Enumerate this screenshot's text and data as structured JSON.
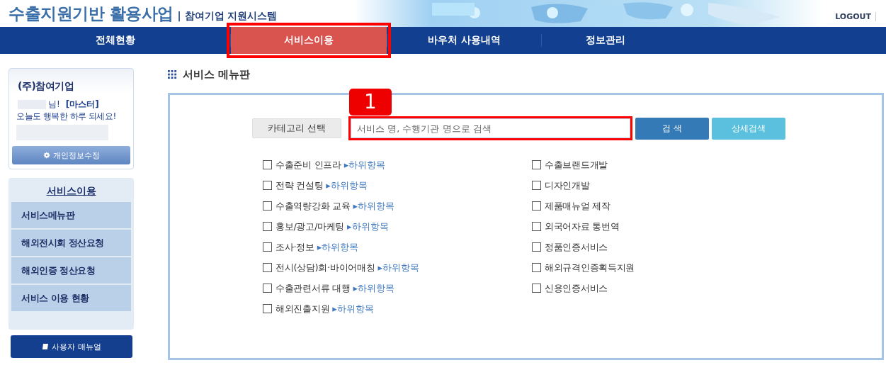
{
  "header": {
    "title": "수출지원기반 활용사업",
    "subtitle": "| 참여기업 지원시스템",
    "logout": "LOGOUT"
  },
  "nav": [
    {
      "label": "전체현황",
      "selected": false,
      "highlighted": false
    },
    {
      "label": "서비스이용",
      "selected": true,
      "highlighted": true
    },
    {
      "label": "바우처 사용내역",
      "selected": false,
      "highlighted": false
    },
    {
      "label": "정보관리",
      "selected": false,
      "highlighted": false
    }
  ],
  "profile": {
    "company": "(주)참여기업",
    "greeting": "님!",
    "role": "[마스터]",
    "message": "오늘도 행복한 하루 되세요!",
    "edit_button": "개인정보수정"
  },
  "side_menu": {
    "title": "서비스이용",
    "items": [
      {
        "label": "서비스메뉴판",
        "selected": false
      },
      {
        "label": "해외전시회 정산요청",
        "selected": false
      },
      {
        "label": "해외인증 정산요청",
        "selected": false
      },
      {
        "label": "서비스 이용 현황",
        "selected": false
      }
    ]
  },
  "manual_button": "사용자 매뉴얼",
  "page_title": "서비스 메뉴판",
  "search": {
    "category_button": "카테고리 선택",
    "placeholder": "서비스 명, 수행기관 명으로 검색",
    "highlighted": true,
    "callout": "1",
    "search_button": "검 색",
    "advanced_button": "상세검색"
  },
  "categories": [
    {
      "label": "수출준비 인프라",
      "sublink": "▸하위항목",
      "checked": false
    },
    {
      "label": "수출브랜드개발",
      "checked": false
    },
    {
      "label": "전략 컨설팅",
      "sublink": "▸하위항목",
      "checked": false
    },
    {
      "label": "디자인개발",
      "checked": false
    },
    {
      "label": "수출역량강화 교육",
      "sublink": "▸하위항목",
      "checked": false
    },
    {
      "label": "제품매뉴얼 제작",
      "checked": false
    },
    {
      "label": "홍보/광고/마케팅",
      "sublink": "▸하위항목",
      "checked": false
    },
    {
      "label": "외국어자료 통번역",
      "checked": false
    },
    {
      "label": "조사·정보",
      "sublink": "▸하위항목",
      "checked": false
    },
    {
      "label": "정품인증서비스",
      "checked": false
    },
    {
      "label": "전시(상담)회·바이어매칭",
      "sublink": "▸하위항목",
      "checked": false
    },
    {
      "label": "해외규격인증획득지원",
      "checked": false
    },
    {
      "label": "수출관련서류 대행",
      "sublink": "▸하위항목",
      "checked": false
    },
    {
      "label": "신용인증서비스",
      "checked": false
    },
    {
      "label": "해외진출지원",
      "sublink": "▸하위항목",
      "checked": false
    }
  ]
}
